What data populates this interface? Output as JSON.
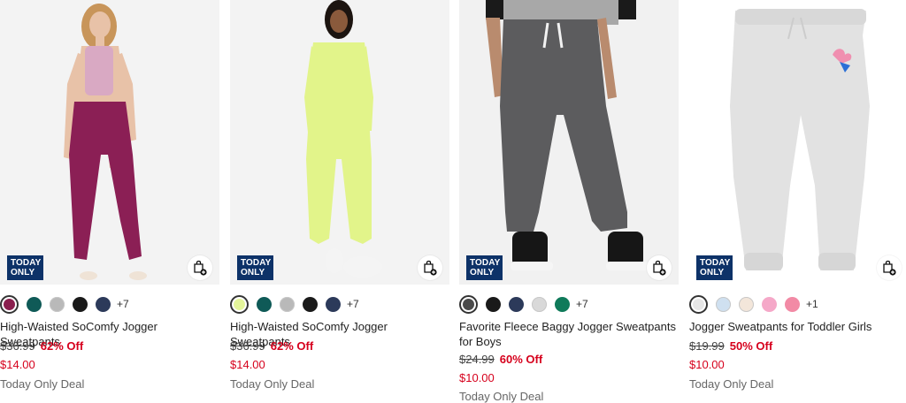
{
  "products": [
    {
      "badge": [
        "TODAY",
        "ONLY"
      ],
      "name": "High-Waisted SoComfy Jogger Sweatpants",
      "was_price": "$36.99",
      "discount": "62% Off",
      "now_price": "$14.00",
      "deal": "Today Only Deal",
      "more_colors": "+7",
      "swatches": [
        "#8a1f4e",
        "#0f5a57",
        "#b9b9b9",
        "#1a1a1a",
        "#2c3a5a"
      ],
      "selected_swatch": 0,
      "image_colors": {
        "bg": "#f3f3f3",
        "garment": "#8b1f55",
        "top": "#d9a9c3",
        "skin": "#e8c2a8",
        "hair": "#c8955a"
      }
    },
    {
      "badge": [
        "TODAY",
        "ONLY"
      ],
      "name": "High-Waisted SoComfy Jogger Sweatpants",
      "was_price": "$36.99",
      "discount": "62% Off",
      "now_price": "$14.00",
      "deal": "Today Only Deal",
      "more_colors": "+7",
      "swatches": [
        "#e4f59a",
        "#0f5a57",
        "#b9b9b9",
        "#1a1a1a",
        "#2c3a5a"
      ],
      "selected_swatch": 0,
      "image_colors": {
        "bg": "#f3f3f3",
        "garment": "#e2f48a",
        "top": "#e2f48a",
        "skin": "#8a5a3c",
        "hair": "#1c1410"
      }
    },
    {
      "badge": [
        "TODAY",
        "ONLY"
      ],
      "name": "Favorite Fleece Baggy Jogger Sweatpants for Boys",
      "was_price": "$24.99",
      "discount": "60% Off",
      "now_price": "$10.00",
      "deal": "Today Only Deal",
      "more_colors": "+7",
      "swatches": [
        "#4a4a4a",
        "#1a1a1a",
        "#2c3a5a",
        "#d9d9d9",
        "#0f7a5a"
      ],
      "selected_swatch": 0,
      "image_colors": {
        "bg": "#f1f1f1",
        "garment": "#5c5c5e",
        "top": "#222222",
        "skin": "#b98b6e",
        "hair": "#222"
      }
    },
    {
      "badge": [
        "TODAY",
        "ONLY"
      ],
      "name": "Jogger Sweatpants for Toddler Girls",
      "was_price": "$19.99",
      "discount": "50% Off",
      "now_price": "$10.00",
      "deal": "Today Only Deal",
      "more_colors": "+1",
      "swatches": [
        "#e6e6e6",
        "#cfe0f0",
        "#f3e6da",
        "#f5a8c8",
        "#f28aa5"
      ],
      "selected_swatch": 0,
      "image_colors": {
        "bg": "#ffffff",
        "garment": "#e2e2e2",
        "top": "#e2e2e2",
        "skin": "#e2e2e2",
        "hair": "#e2e2e2"
      }
    }
  ],
  "icons": {
    "bag": "shopping-bag-plus-icon"
  },
  "colors": {
    "badge_bg": "#0d3268",
    "sale_red": "#d6001c"
  }
}
